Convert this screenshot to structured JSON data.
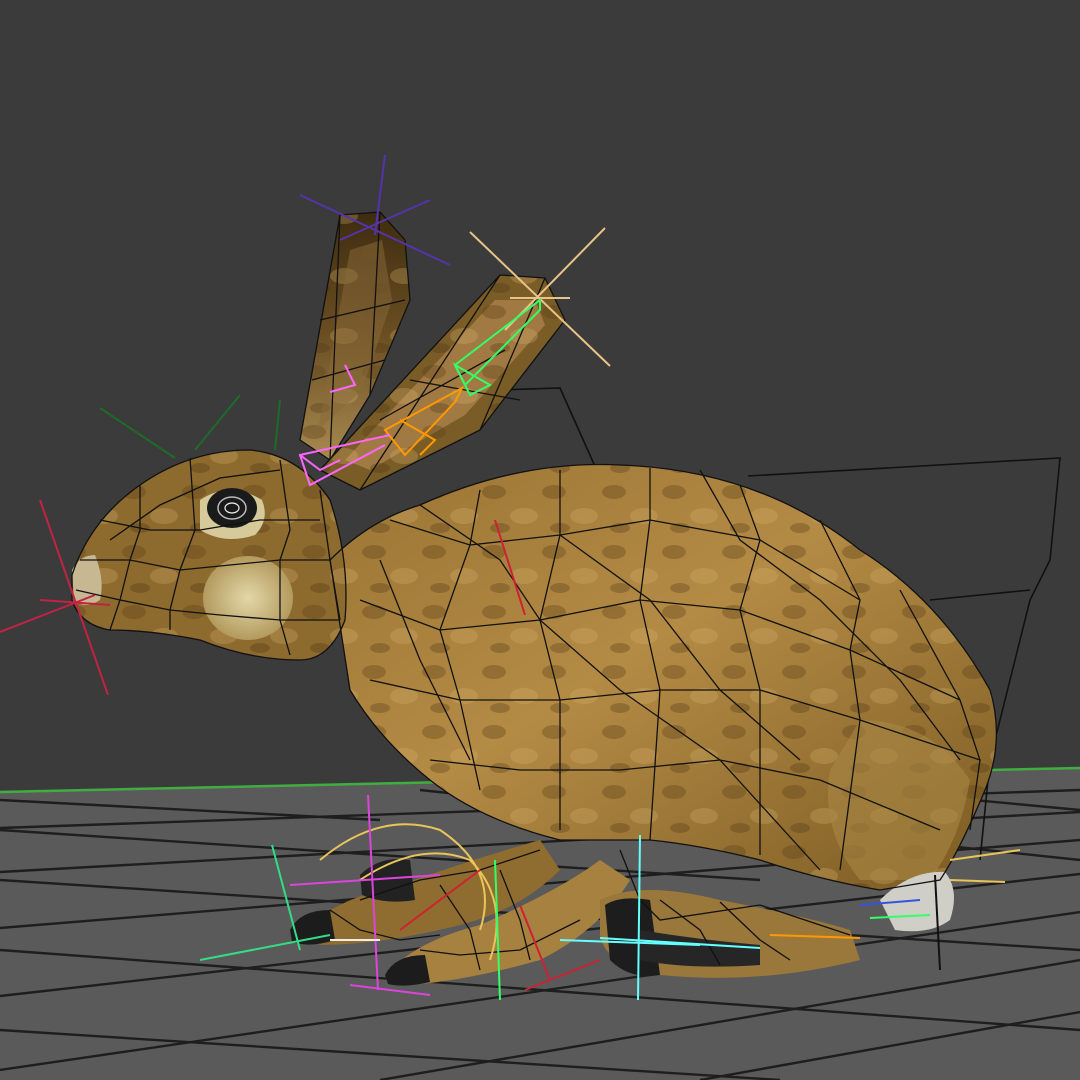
{
  "viewport": {
    "background_color": "#3b3b3b",
    "floor_color": "#5a5a5a",
    "grid_line_color": "#1e1e1e",
    "horizon_green_color": "#3fae3f"
  },
  "model": {
    "type": "rigged-hare",
    "mode": "wireframe-on-shaded",
    "skin_colors": [
      "#6b5020",
      "#a27f3e",
      "#c8a45c",
      "#4a3515"
    ],
    "wire_color": "#111111",
    "cream_color": "#d8cfa0"
  },
  "rig": {
    "control_colors": [
      "#ff66ff",
      "#33ff66",
      "#ff9900",
      "#ffcc66",
      "#66ffff",
      "#ff3355",
      "#5533aa",
      "#dddddd"
    ],
    "controls": [
      "ear-locator-left",
      "ear-locator-right",
      "ear-bone-chain",
      "nose-locator",
      "head-locator",
      "front-paw-controls",
      "hind-foot-control",
      "tail-locator",
      "spine-curve"
    ]
  }
}
